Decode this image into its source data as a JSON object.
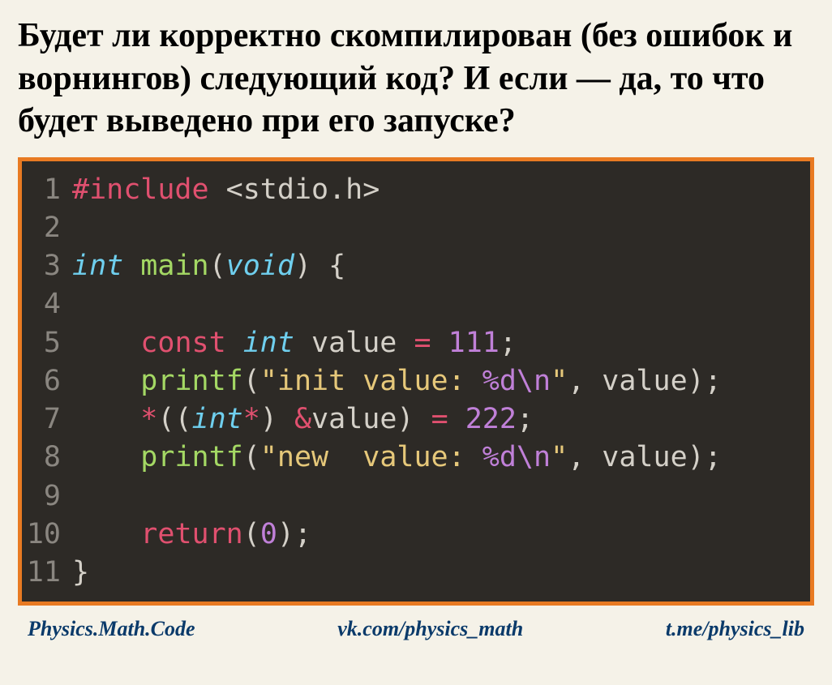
{
  "question": "Будет ли корректно скомпилирован (без ошибок и ворнингов) следующий код? И если — да, то что будет выведено при его запуске?",
  "code": {
    "lines": [
      {
        "num": "1",
        "tokens": [
          {
            "t": "#include",
            "c": "tok-pp"
          },
          {
            "t": " ",
            "c": ""
          },
          {
            "t": "<stdio.h>",
            "c": "tok-inc"
          }
        ]
      },
      {
        "num": "2",
        "tokens": []
      },
      {
        "num": "3",
        "tokens": [
          {
            "t": "int",
            "c": "tok-type"
          },
          {
            "t": " ",
            "c": ""
          },
          {
            "t": "main",
            "c": "tok-fn"
          },
          {
            "t": "(",
            "c": "tok-punc"
          },
          {
            "t": "void",
            "c": "tok-type"
          },
          {
            "t": ") {",
            "c": "tok-punc"
          }
        ]
      },
      {
        "num": "4",
        "tokens": []
      },
      {
        "num": "5",
        "tokens": [
          {
            "t": "    ",
            "c": ""
          },
          {
            "t": "const",
            "c": "tok-const"
          },
          {
            "t": " ",
            "c": ""
          },
          {
            "t": "int",
            "c": "tok-type"
          },
          {
            "t": " value ",
            "c": "tok-ident"
          },
          {
            "t": "=",
            "c": "tok-kw"
          },
          {
            "t": " ",
            "c": ""
          },
          {
            "t": "111",
            "c": "tok-num"
          },
          {
            "t": ";",
            "c": "tok-punc"
          }
        ]
      },
      {
        "num": "6",
        "tokens": [
          {
            "t": "    ",
            "c": ""
          },
          {
            "t": "printf",
            "c": "tok-fn"
          },
          {
            "t": "(",
            "c": "tok-punc"
          },
          {
            "t": "\"init value: ",
            "c": "tok-str"
          },
          {
            "t": "%d",
            "c": "tok-esc"
          },
          {
            "t": "\\n",
            "c": "tok-esc"
          },
          {
            "t": "\"",
            "c": "tok-str"
          },
          {
            "t": ", value);",
            "c": "tok-punc"
          }
        ]
      },
      {
        "num": "7",
        "tokens": [
          {
            "t": "    ",
            "c": ""
          },
          {
            "t": "*",
            "c": "tok-kw"
          },
          {
            "t": "((",
            "c": "tok-punc"
          },
          {
            "t": "int",
            "c": "tok-type"
          },
          {
            "t": "*",
            "c": "tok-kw"
          },
          {
            "t": ") ",
            "c": "tok-punc"
          },
          {
            "t": "&",
            "c": "tok-kw"
          },
          {
            "t": "value) ",
            "c": "tok-punc"
          },
          {
            "t": "=",
            "c": "tok-kw"
          },
          {
            "t": " ",
            "c": ""
          },
          {
            "t": "222",
            "c": "tok-num"
          },
          {
            "t": ";",
            "c": "tok-punc"
          }
        ]
      },
      {
        "num": "8",
        "tokens": [
          {
            "t": "    ",
            "c": ""
          },
          {
            "t": "printf",
            "c": "tok-fn"
          },
          {
            "t": "(",
            "c": "tok-punc"
          },
          {
            "t": "\"new  value: ",
            "c": "tok-str"
          },
          {
            "t": "%d",
            "c": "tok-esc"
          },
          {
            "t": "\\n",
            "c": "tok-esc"
          },
          {
            "t": "\"",
            "c": "tok-str"
          },
          {
            "t": ", value);",
            "c": "tok-punc"
          }
        ]
      },
      {
        "num": "9",
        "tokens": []
      },
      {
        "num": "10",
        "tokens": [
          {
            "t": "    ",
            "c": ""
          },
          {
            "t": "return",
            "c": "tok-kw"
          },
          {
            "t": "(",
            "c": "tok-punc"
          },
          {
            "t": "0",
            "c": "tok-num"
          },
          {
            "t": ");",
            "c": "tok-punc"
          }
        ]
      },
      {
        "num": "11",
        "tokens": [
          {
            "t": "}",
            "c": "tok-punc"
          }
        ]
      }
    ]
  },
  "footer": {
    "left": "Physics.Math.Code",
    "center": "vk.com/physics_math",
    "right": "t.me/physics_lib"
  }
}
